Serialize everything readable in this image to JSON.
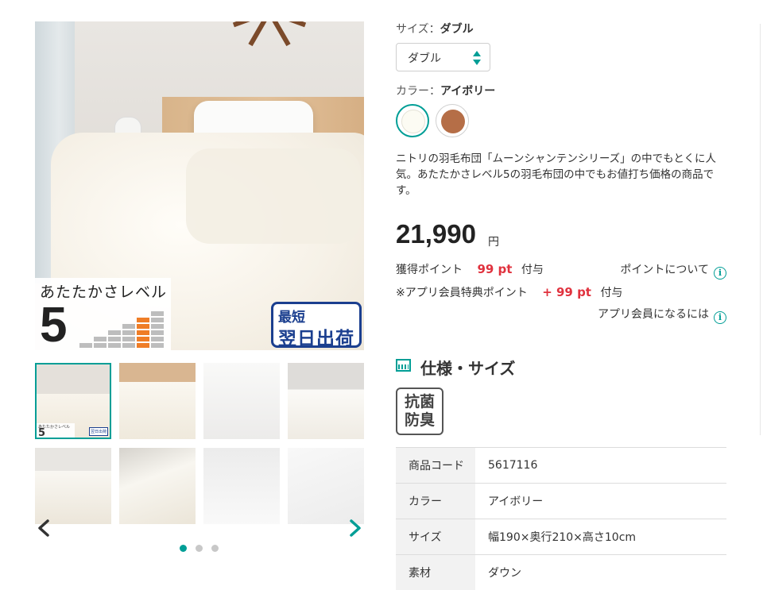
{
  "gallery": {
    "main_image_alt": "ニトリの羽毛布団",
    "warmth_label": "あたたかさレベル",
    "warmth_level": "5",
    "warmth_level_value": 5,
    "warmth_level_max": 6,
    "shipping_badge": {
      "line1": "最短",
      "line2": "翌日出荷"
    },
    "thumbnail_caption_title": "あたたかさレベル",
    "thumbnail_caption_level": "5",
    "thumbnail_caption_badge": "翌日出荷",
    "thumbnail_count": 8,
    "selected_thumbnail": 1,
    "pagination": {
      "pages": 3,
      "current": 1
    },
    "prev_icon": "chevron-left-icon",
    "next_icon": "chevron-right-icon"
  },
  "options": {
    "size_label": "サイズ：",
    "size_value": "ダブル",
    "size_select_value": "ダブル",
    "color_label": "カラー：",
    "color_value": "アイボリー",
    "colors": [
      {
        "name": "アイボリー",
        "hex": "#fcfbf3",
        "selected": true
      },
      {
        "name": "ブラウン",
        "hex": "#b56e47",
        "selected": false
      }
    ]
  },
  "description": "ニトリの羽毛布団「ムーンシャンテンシリーズ」の中でもとくに人気。あたたかさレベル5の羽毛布団の中でもお値打ち価格の商品です。",
  "price": {
    "amount": "21,990",
    "unit": "円"
  },
  "points": {
    "earned_label": "獲得ポイント",
    "earned_value": "99 pt",
    "earned_suffix": "付与",
    "about_link": "ポイントについて",
    "app_label": "※アプリ会員特典ポイント",
    "app_value": "+ 99 pt",
    "app_suffix": "付与",
    "app_link": "アプリ会員になるには",
    "info_icon_glyph": "i"
  },
  "spec": {
    "title": "仕様・サイズ",
    "badge_line1": "抗菌",
    "badge_line2": "防臭",
    "rows": [
      {
        "key": "商品コード",
        "value": "5617116"
      },
      {
        "key": "カラー",
        "value": "アイボリー"
      },
      {
        "key": "サイズ",
        "value": "幅190×奥行210×高さ10cm"
      },
      {
        "key": "素材",
        "value": "ダウン"
      }
    ]
  },
  "colors": {
    "accent": "#009e96",
    "point_red": "#e0323e",
    "shipping_blue": "#1b3f8f",
    "warmth_orange": "#ef7d27"
  }
}
